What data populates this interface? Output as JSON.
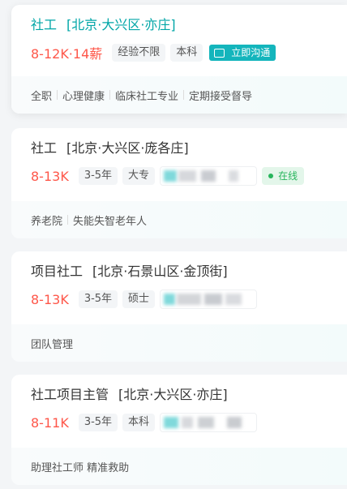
{
  "jobs": [
    {
      "title": "社工",
      "location": "[北京·大兴区·亦庄]",
      "salary": "8-12K·14薪",
      "tags": [
        "经验不限",
        "本科"
      ],
      "chat_label": "立即沟通",
      "keywords": [
        "全职",
        "心理健康",
        "临床社工专业",
        "定期接受督导"
      ]
    },
    {
      "title": "社工",
      "location": "[北京·大兴区·庞各庄]",
      "salary": "8-13K",
      "tags": [
        "3-5年",
        "大专"
      ],
      "online_label": "在线",
      "keywords": [
        "养老院",
        "失能失智老年人"
      ]
    },
    {
      "title": "项目社工",
      "location": "[北京·石景山区·金顶街]",
      "salary": "8-13K",
      "tags": [
        "3-5年",
        "硕士"
      ],
      "keywords": [
        "团队管理"
      ]
    },
    {
      "title": "社工项目主管",
      "location": "[北京·大兴区·亦庄]",
      "salary": "8-11K",
      "tags": [
        "3-5年",
        "本科"
      ],
      "keywords": [
        "助理社工师 精准救助"
      ]
    }
  ],
  "colors": {
    "accent": "#00a6a7",
    "salary": "#fe574a",
    "chat_button": "#14b5bc",
    "online": "#27b55c"
  }
}
